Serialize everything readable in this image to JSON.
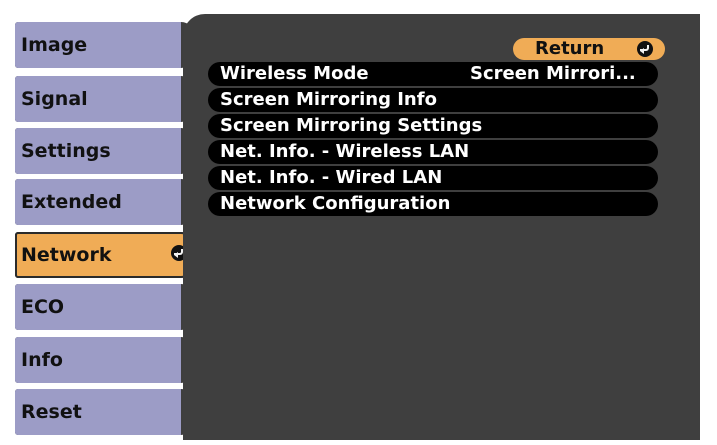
{
  "sidebar": {
    "items": [
      {
        "label": "Image"
      },
      {
        "label": "Signal"
      },
      {
        "label": "Settings"
      },
      {
        "label": "Extended"
      },
      {
        "label": "Network"
      },
      {
        "label": "ECO"
      },
      {
        "label": "Info"
      },
      {
        "label": "Reset"
      }
    ],
    "selected": "Network"
  },
  "panel": {
    "return_label": "Return",
    "rows": [
      {
        "label": "Wireless Mode",
        "value": "Screen Mirrori..."
      },
      {
        "label": "Screen Mirroring Info"
      },
      {
        "label": "Screen Mirroring Settings"
      },
      {
        "label": "Net. Info. - Wireless LAN"
      },
      {
        "label": "Net. Info. - Wired LAN"
      },
      {
        "label": "Network Configuration"
      }
    ]
  },
  "colors": {
    "panel_bg": "#3f3f3f",
    "sidebar_item": "#9c9cc6",
    "selected_accent": "#f0ac56",
    "row_bg": "#000000"
  },
  "icons": [
    "enter-icon"
  ]
}
